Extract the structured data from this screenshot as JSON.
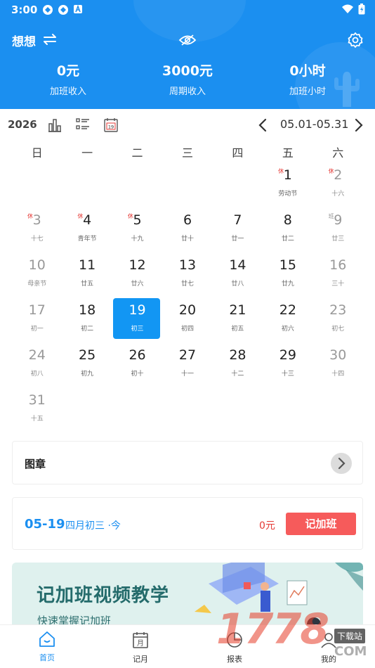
{
  "status": {
    "time": "3:00"
  },
  "header": {
    "title": "想想",
    "stats": [
      {
        "value": "0元",
        "label": "加班收入"
      },
      {
        "value": "3000元",
        "label": "周期收入"
      },
      {
        "value": "0小时",
        "label": "加班小时"
      }
    ]
  },
  "toolbar": {
    "year": "2026",
    "range": "05.01-05.31"
  },
  "calendar": {
    "weekdays": [
      "日",
      "一",
      "二",
      "三",
      "四",
      "五",
      "六"
    ],
    "selected_day": 19,
    "days": [
      {
        "day": "1",
        "sub": "劳动节",
        "col": 5,
        "row": 0,
        "badge": "休"
      },
      {
        "day": "2",
        "sub": "十六",
        "col": 6,
        "row": 0,
        "badge": "休"
      },
      {
        "day": "3",
        "sub": "十七",
        "col": 0,
        "row": 1,
        "badge": "休"
      },
      {
        "day": "4",
        "sub": "青年节",
        "col": 1,
        "row": 1,
        "badge": "休"
      },
      {
        "day": "5",
        "sub": "十九",
        "col": 2,
        "row": 1,
        "badge": "休"
      },
      {
        "day": "6",
        "sub": "廿十",
        "col": 3,
        "row": 1
      },
      {
        "day": "7",
        "sub": "廿一",
        "col": 4,
        "row": 1
      },
      {
        "day": "8",
        "sub": "廿二",
        "col": 5,
        "row": 1
      },
      {
        "day": "9",
        "sub": "廿三",
        "col": 6,
        "row": 1,
        "badge": "班",
        "badge_type": "ban"
      },
      {
        "day": "10",
        "sub": "母亲节",
        "col": 0,
        "row": 2
      },
      {
        "day": "11",
        "sub": "廿五",
        "col": 1,
        "row": 2
      },
      {
        "day": "12",
        "sub": "廿六",
        "col": 2,
        "row": 2
      },
      {
        "day": "13",
        "sub": "廿七",
        "col": 3,
        "row": 2
      },
      {
        "day": "14",
        "sub": "廿八",
        "col": 4,
        "row": 2
      },
      {
        "day": "15",
        "sub": "廿九",
        "col": 5,
        "row": 2
      },
      {
        "day": "16",
        "sub": "三十",
        "col": 6,
        "row": 2
      },
      {
        "day": "17",
        "sub": "初一",
        "col": 0,
        "row": 3
      },
      {
        "day": "18",
        "sub": "初二",
        "col": 1,
        "row": 3
      },
      {
        "day": "19",
        "sub": "初三",
        "col": 2,
        "row": 3
      },
      {
        "day": "20",
        "sub": "初四",
        "col": 3,
        "row": 3
      },
      {
        "day": "21",
        "sub": "初五",
        "col": 4,
        "row": 3
      },
      {
        "day": "22",
        "sub": "初六",
        "col": 5,
        "row": 3
      },
      {
        "day": "23",
        "sub": "初七",
        "col": 6,
        "row": 3
      },
      {
        "day": "24",
        "sub": "初八",
        "col": 0,
        "row": 4
      },
      {
        "day": "25",
        "sub": "初九",
        "col": 1,
        "row": 4
      },
      {
        "day": "26",
        "sub": "初十",
        "col": 2,
        "row": 4
      },
      {
        "day": "27",
        "sub": "十一",
        "col": 3,
        "row": 4
      },
      {
        "day": "28",
        "sub": "十二",
        "col": 4,
        "row": 4
      },
      {
        "day": "29",
        "sub": "十三",
        "col": 5,
        "row": 4
      },
      {
        "day": "30",
        "sub": "十四",
        "col": 6,
        "row": 4
      },
      {
        "day": "31",
        "sub": "十五",
        "col": 0,
        "row": 5
      }
    ]
  },
  "seal": {
    "title": "图章"
  },
  "overtime": {
    "date": "05-19",
    "lunar": "四月初三 ·今",
    "amount": "0元",
    "button": "记加班"
  },
  "banner": {
    "title": "记加班视频教学",
    "subtitle": "快速掌握记加班"
  },
  "bottom_nav": [
    {
      "label": "首页",
      "icon": "home-icon"
    },
    {
      "label": "记月",
      "icon": "calendar-month-icon"
    },
    {
      "label": "报表",
      "icon": "report-icon"
    },
    {
      "label": "我的",
      "icon": "profile-icon"
    }
  ],
  "watermark": {
    "text": "1778",
    "tag": "下载站",
    "domain": "COM"
  },
  "colors": {
    "primary": "#1b8ff0",
    "selected": "#1296f3",
    "accent_red": "#f65b5b"
  }
}
